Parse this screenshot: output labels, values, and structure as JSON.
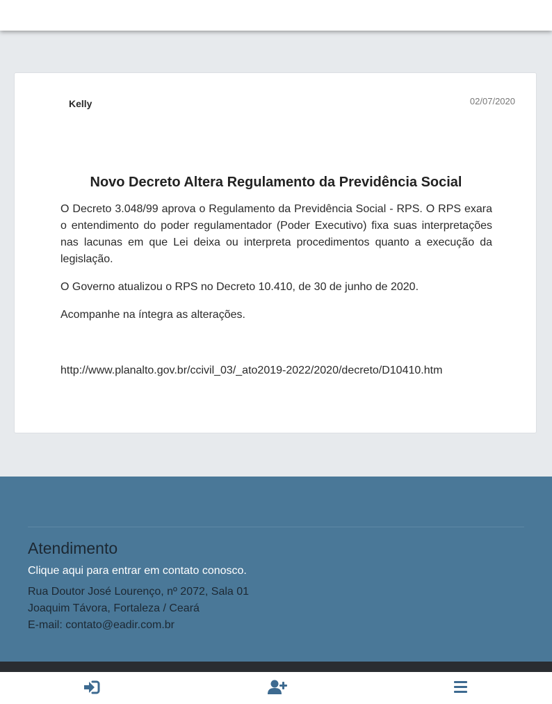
{
  "post": {
    "author": "Kelly",
    "date": "02/07/2020",
    "title": "Novo Decreto Altera Regulamento da Previdência Social",
    "paragraphs": [
      "O Decreto 3.048/99 aprova o Regulamento da Previdência Social - RPS. O RPS exara o entendimento do poder regulamentador (Poder Executivo) fixa suas interpretações nas lacunas em que Lei deixa ou interpreta procedimentos quanto a execução da legislação.",
      "O Governo atualizou o RPS no Decreto 10.410, de 30 de junho de 2020.",
      "Acompanhe na íntegra as alterações."
    ],
    "link": "http://www.planalto.gov.br/ccivil_03/_ato2019-2022/2020/decreto/D10410.htm"
  },
  "footer": {
    "heading": "Atendimento",
    "contact_link": "Clique aqui para entrar em contato conosco.",
    "address_line1": "Rua Doutor José Lourenço, nº 2072, Sala 01",
    "address_line2": "Joaquim Távora, Fortaleza / Ceará",
    "email": "E-mail: contato@eadir.com.br"
  },
  "bottom_nav": {
    "icons": [
      "sign-in-icon",
      "user-plus-icon",
      "menu-icon"
    ],
    "icon_color": "#3d6a90"
  },
  "colors": {
    "footer_bg": "#4a7898",
    "page_bg": "#e7eaed"
  }
}
